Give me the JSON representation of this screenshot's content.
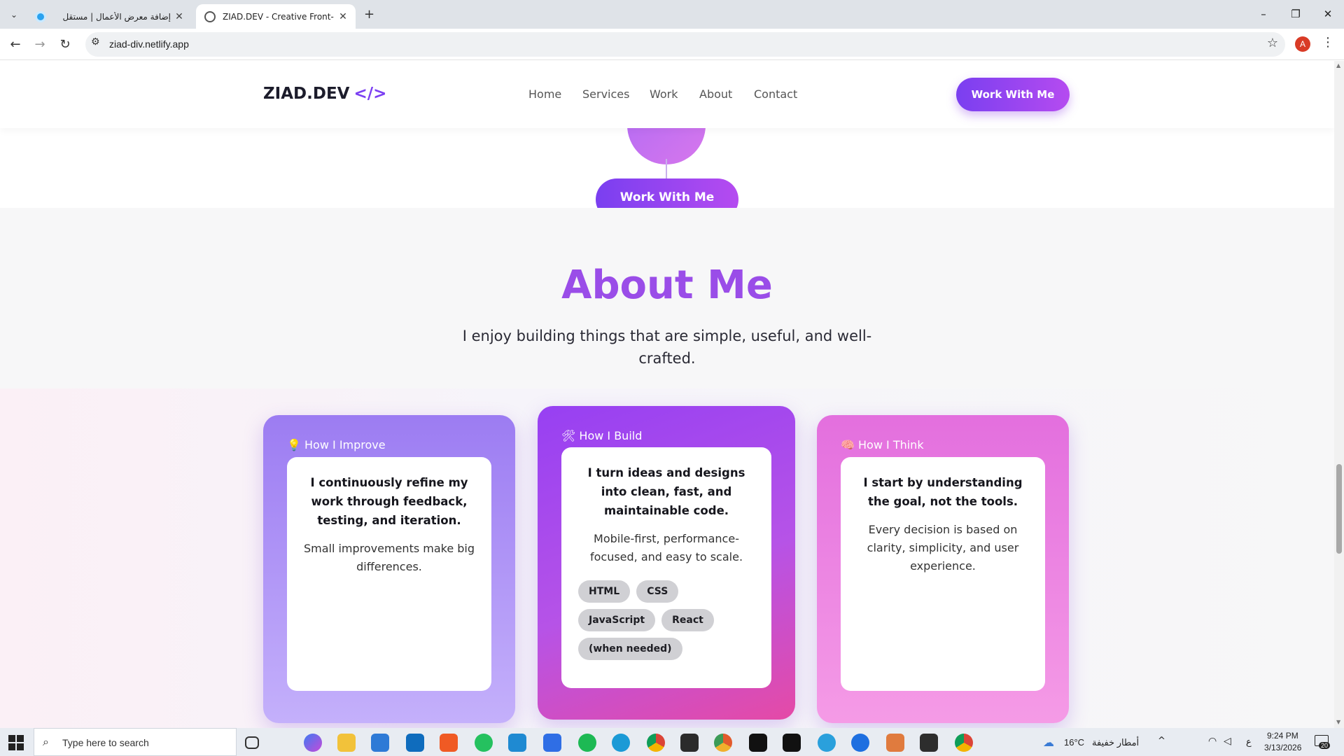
{
  "browser": {
    "tabs": [
      {
        "title": "إضافة معرض الأعمال | مستقل",
        "active": false
      },
      {
        "title": "ZIAD.DEV - Creative Front-End",
        "active": true
      }
    ],
    "new_tab_glyph": "+",
    "url": "ziad-div.netlify.app",
    "profile_initial": "A",
    "window_controls": [
      "–",
      "❐",
      "✕"
    ]
  },
  "site": {
    "logo_text": "ZIAD.DEV",
    "logo_code": "</>",
    "nav": [
      "Home",
      "Services",
      "Work",
      "About",
      "Contact"
    ],
    "header_cta": "Work With Me",
    "hero_cta": "Work With Me"
  },
  "about": {
    "title": "About Me",
    "subtitle": "I enjoy building things that are simple, useful, and well-crafted.",
    "cards": [
      {
        "icon": "lightbulb-icon",
        "emoji": "💡",
        "label": "How I Improve",
        "lead": "I continuously refine my work through feedback, testing, and iteration.",
        "note": "Small improvements make big differences."
      },
      {
        "icon": "tools-icon",
        "emoji": "🛠",
        "label": "How I Build",
        "lead": "I turn ideas and designs into clean, fast, and maintainable code.",
        "note": "Mobile-first, performance-focused, and easy to scale.",
        "chips": [
          "HTML",
          "CSS",
          "JavaScript",
          "React",
          "(when needed)"
        ]
      },
      {
        "icon": "brain-icon",
        "emoji": "🧠",
        "label": "How I Think",
        "lead": "I start by understanding the goal, not the tools.",
        "note": "Every decision is based on clarity, simplicity, and user experience."
      }
    ]
  },
  "taskbar": {
    "search_placeholder": "Type here to search",
    "weather_temp": "16°C",
    "weather_text": "أمطار خفيفة",
    "time": "9:24 PM",
    "date": "3/13/2026",
    "notification_count": "20",
    "lang": "ع"
  },
  "colors": {
    "brand": "#7b3ff2",
    "title_purple": "#9a4de8"
  }
}
